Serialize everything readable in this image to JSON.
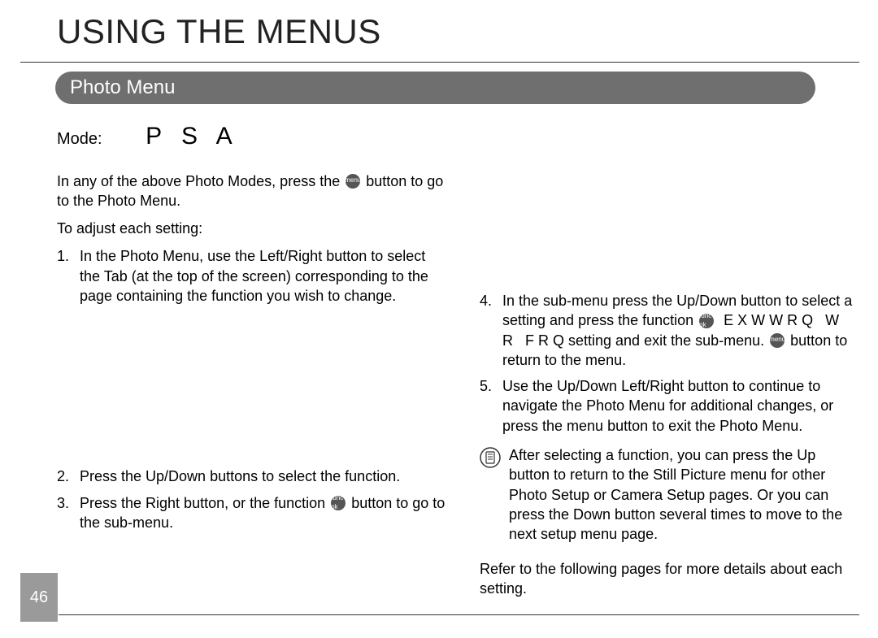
{
  "chapter_title": "USING THE MENUS",
  "section_title": "Photo Menu",
  "mode_label": "Mode:",
  "mode_letters": "P S A",
  "intro_para": "In any of the above Photo Modes, press the     button to go to the Photo Menu.",
  "adjust_label": "To adjust each setting:",
  "steps_left": [
    {
      "num": "1.",
      "text": "In the Photo Menu, use the Left/Right button to select the Tab (at the top of the screen) corresponding to the page containing the function you wish to change."
    },
    {
      "num": "2.",
      "text": "Press the Up/Down buttons to select the function."
    },
    {
      "num": "3.",
      "text": "Press the Right button, or the function     button to go to the sub-menu."
    }
  ],
  "steps_right": [
    {
      "num": "4.",
      "text": "In the sub-menu press the Up/Down button to select a setting and press the function     E X W W R Q   W R   F R Q setting and exit the sub-menu.     button to return to the menu."
    },
    {
      "num": "5.",
      "text": "Use the Up/Down Left/Right button to continue to navigate the Photo Menu for additional changes, or press the menu button to exit the Photo Menu."
    }
  ],
  "note_text": "After selecting a function, you can press the Up button to return to the Still Picture menu for other Photo Setup or Camera Setup pages. Or you can press the Down button several times to move to the next setup menu page.",
  "refer_text": "Refer to the following pages for more details about each setting.",
  "page_number": "46",
  "icon_labels": {
    "menu": "menu",
    "func": "func ok"
  }
}
